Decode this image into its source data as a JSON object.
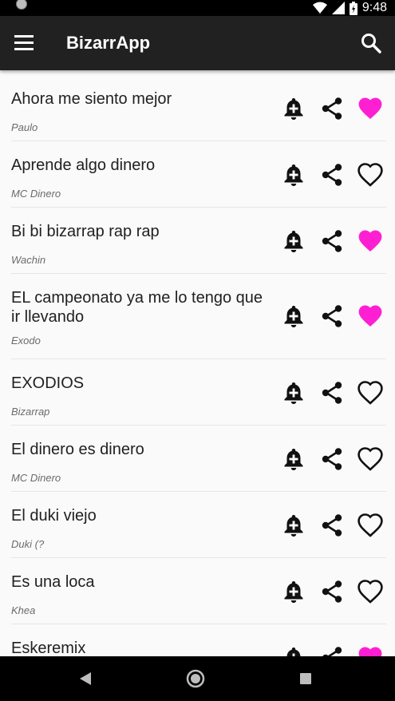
{
  "status": {
    "time": "9:48",
    "icons": [
      "wifi-icon",
      "signal-icon",
      "battery-icon"
    ]
  },
  "app": {
    "title": "BizarrApp",
    "accent": "#ff1fd2",
    "bar_color": "#212121"
  },
  "songs": [
    {
      "title": "Ahora me siento mejor",
      "artist": "Paulo",
      "favorite": true
    },
    {
      "title": "Aprende algo dinero",
      "artist": "MC Dinero",
      "favorite": false
    },
    {
      "title": "Bi bi bizarrap rap rap",
      "artist": "Wachin",
      "favorite": true
    },
    {
      "title": "EL campeonato ya me lo tengo que ir llevando",
      "artist": "Exodo",
      "favorite": true
    },
    {
      "title": "EXODIOS",
      "artist": "Bizarrap",
      "favorite": false
    },
    {
      "title": "El dinero es dinero",
      "artist": "MC Dinero",
      "favorite": false
    },
    {
      "title": "El duki viejo",
      "artist": "Duki (?",
      "favorite": false
    },
    {
      "title": "Es una loca",
      "artist": "Khea",
      "favorite": false
    },
    {
      "title": "Eskeremix",
      "artist": "",
      "favorite": true
    }
  ],
  "navigation": {
    "buttons": [
      "back-icon",
      "home-icon",
      "recents-icon"
    ]
  }
}
